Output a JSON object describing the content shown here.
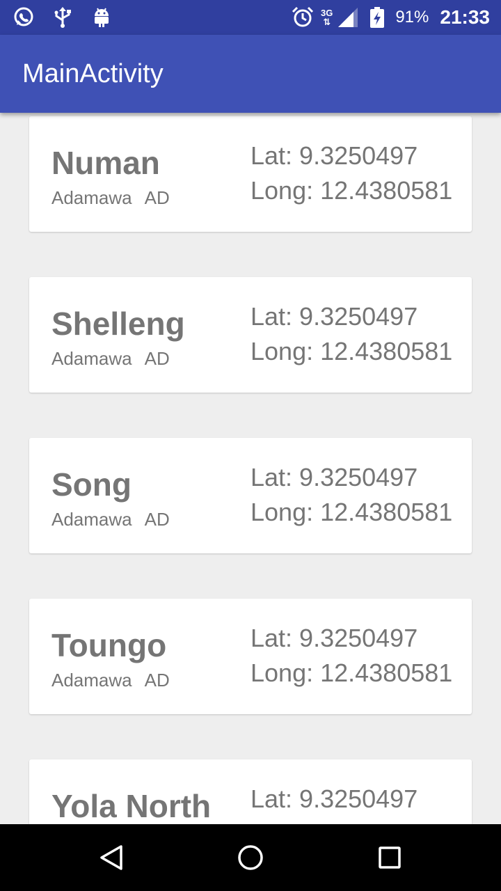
{
  "status_bar": {
    "left_icons": [
      "whatsapp-icon",
      "usb-icon",
      "android-icon"
    ],
    "network_type": "3G",
    "battery_percent": "91%",
    "time": "21:33"
  },
  "app_bar": {
    "title": "MainActivity"
  },
  "locations": [
    {
      "name": "Numan",
      "state": "Adamawa",
      "code": "AD",
      "lat": "Lat: 9.3250497",
      "long": "Long: 12.4380581"
    },
    {
      "name": "Shelleng",
      "state": "Adamawa",
      "code": "AD",
      "lat": "Lat: 9.3250497",
      "long": "Long: 12.4380581"
    },
    {
      "name": "Song",
      "state": "Adamawa",
      "code": "AD",
      "lat": "Lat: 9.3250497",
      "long": "Long: 12.4380581"
    },
    {
      "name": "Toungo",
      "state": "Adamawa",
      "code": "AD",
      "lat": "Lat: 9.3250497",
      "long": "Long: 12.4380581"
    },
    {
      "name": "Yola North",
      "lat": "Lat: 9.3250497"
    }
  ],
  "nav_bar": {
    "icons": [
      "back-icon",
      "home-icon",
      "recents-icon"
    ]
  }
}
